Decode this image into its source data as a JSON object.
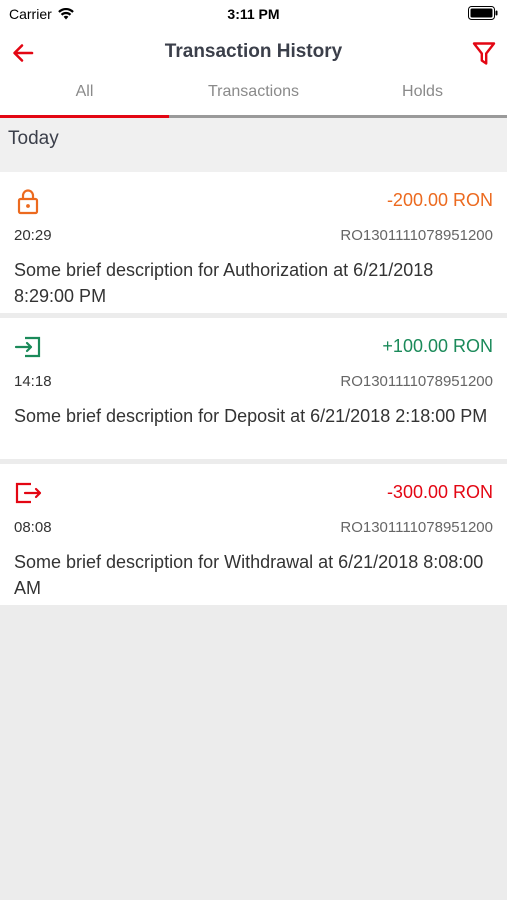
{
  "status_bar": {
    "carrier": "Carrier",
    "time": "3:11 PM"
  },
  "header": {
    "title": "Transaction History",
    "back_icon": "arrow-left-icon",
    "filter_icon": "funnel-icon",
    "accent_color": "#e30613"
  },
  "tabs": [
    {
      "label": "All",
      "active": true
    },
    {
      "label": "Transactions",
      "active": false
    },
    {
      "label": "Holds",
      "active": false
    }
  ],
  "section": {
    "label": "Today"
  },
  "transactions": [
    {
      "type": "authorization",
      "icon": "lock-icon",
      "color": "#ec6a1f",
      "amount": "-200.00 RON",
      "time": "20:29",
      "iban": "RO1301111078951200",
      "description": "Some brief description for Authorization at 6/21/2018 8:29:00 PM"
    },
    {
      "type": "deposit",
      "icon": "login-icon",
      "color": "#1b8a5a",
      "amount": "+100.00 RON",
      "time": "14:18",
      "iban": "RO1301111078951200",
      "description": "Some brief description for Deposit at 6/21/2018 2:18:00 PM"
    },
    {
      "type": "withdrawal",
      "icon": "logout-icon",
      "color": "#e30613",
      "amount": "-300.00 RON",
      "time": "08:08",
      "iban": "RO1301111078951200",
      "description": "Some brief description for Withdrawal at 6/21/2018 8:08:00 AM"
    }
  ]
}
